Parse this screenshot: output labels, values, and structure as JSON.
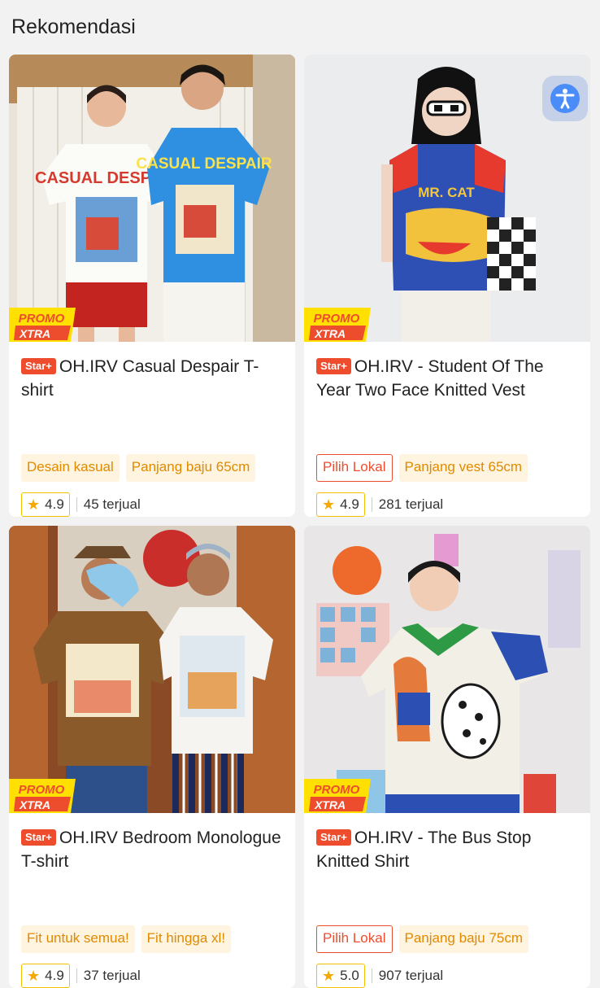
{
  "section_title": "Rekomendasi",
  "promo_badge": {
    "line1": "PROMO",
    "line2": "XTRA"
  },
  "products": [
    {
      "badge": "Star+",
      "title": "OH.IRV Casual Despair T-shirt",
      "tags": [
        {
          "text": "Desain kasual",
          "style": "orange"
        },
        {
          "text": "Panjang baju 65cm",
          "style": "orange"
        }
      ],
      "rating": "4.9",
      "sold": "45 terjual"
    },
    {
      "badge": "Star+",
      "title": "OH.IRV - Student Of The Year Two Face Knitted Vest",
      "tags": [
        {
          "text": "Pilih Lokal",
          "style": "red"
        },
        {
          "text": "Panjang vest 65cm",
          "style": "orange"
        }
      ],
      "rating": "4.9",
      "sold": "281 terjual"
    },
    {
      "badge": "Star+",
      "title": "OH.IRV Bedroom Monologue T-shirt",
      "tags": [
        {
          "text": "Fit untuk semua!",
          "style": "orange"
        },
        {
          "text": "Fit hingga xl!",
          "style": "orange"
        }
      ],
      "rating": "4.9",
      "sold": "37 terjual"
    },
    {
      "badge": "Star+",
      "title": "OH.IRV - The Bus Stop Knitted Shirt",
      "tags": [
        {
          "text": "Pilih Lokal",
          "style": "red"
        },
        {
          "text": "Panjang baju 75cm",
          "style": "orange"
        }
      ],
      "rating": "5.0",
      "sold": "907 terjual"
    }
  ],
  "print_text": {
    "p1": "CASUAL DESPAIR",
    "p2": "MR. CAT"
  },
  "icons": {
    "star": "star-icon",
    "accessibility": "accessibility-icon"
  }
}
